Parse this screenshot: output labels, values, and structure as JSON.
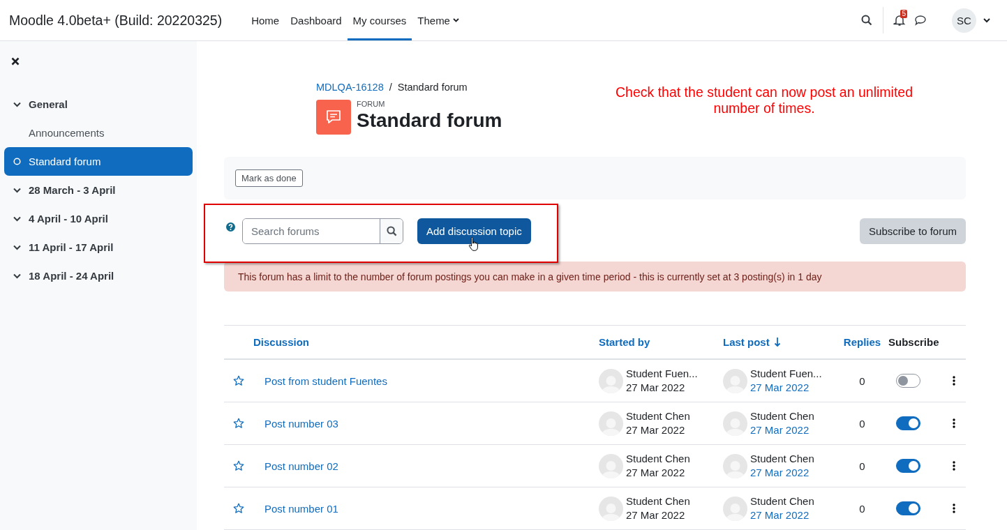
{
  "navbar": {
    "site_name": "Moodle 4.0beta+ (Build: 20220325)",
    "links": [
      {
        "label": "Home",
        "selected": false,
        "has_menu": false
      },
      {
        "label": "Dashboard",
        "selected": false,
        "has_menu": false
      },
      {
        "label": "My courses",
        "selected": true,
        "has_menu": false
      },
      {
        "label": "Theme",
        "selected": false,
        "has_menu": true
      }
    ],
    "notification_count": "5",
    "user_initials": "SC"
  },
  "sidebar": {
    "items": [
      {
        "label": "General",
        "kind": "section",
        "selected": false
      },
      {
        "label": "Announcements",
        "kind": "activity",
        "selected": false
      },
      {
        "label": "Standard forum",
        "kind": "activity",
        "selected": true
      },
      {
        "label": "28 March - 3 April",
        "kind": "section",
        "selected": false
      },
      {
        "label": "4 April - 10 April",
        "kind": "section",
        "selected": false
      },
      {
        "label": "11 April - 17 April",
        "kind": "section",
        "selected": false
      },
      {
        "label": "18 April - 24 April",
        "kind": "section",
        "selected": false
      }
    ]
  },
  "breadcrumb": [
    "MDLQA-16128",
    "Standard forum"
  ],
  "breadcrumb_separator": "/",
  "activity": {
    "type_label": "FORUM",
    "title": "Standard forum"
  },
  "annotation": "Check that the student can now post an unlimited number of times.",
  "completion_button": "Mark as done",
  "search": {
    "placeholder": "Search forums"
  },
  "add_button": "Add discussion topic",
  "subscribe_button": "Subscribe to forum",
  "alert": "This forum has a limit to the number of forum postings you can make in a given time period - this is currently set at 3 posting(s) in 1 day",
  "table": {
    "columns": [
      {
        "label": "Discussion",
        "sorted": false,
        "link": true
      },
      {
        "label": "Started by",
        "sorted": false,
        "link": true
      },
      {
        "label": "Last post",
        "sorted": true,
        "link": true
      },
      {
        "label": "Replies",
        "sorted": false,
        "link": true
      },
      {
        "label": "Subscribe",
        "sorted": false,
        "link": false
      }
    ],
    "rows": [
      {
        "title": "Post from student Fuentes",
        "started_by": {
          "name": "Student Fuen...",
          "date": "27 Mar 2022"
        },
        "last_post": {
          "name": "Student Fuen...",
          "date": "27 Mar 2022"
        },
        "replies": "0",
        "subscribed": false
      },
      {
        "title": "Post number 03",
        "started_by": {
          "name": "Student Chen",
          "date": "27 Mar 2022"
        },
        "last_post": {
          "name": "Student Chen",
          "date": "27 Mar 2022"
        },
        "replies": "0",
        "subscribed": true
      },
      {
        "title": "Post number 02",
        "started_by": {
          "name": "Student Chen",
          "date": "27 Mar 2022"
        },
        "last_post": {
          "name": "Student Chen",
          "date": "27 Mar 2022"
        },
        "replies": "0",
        "subscribed": true
      },
      {
        "title": "Post number 01",
        "started_by": {
          "name": "Student Chen",
          "date": "27 Mar 2022"
        },
        "last_post": {
          "name": "Student Chen",
          "date": "27 Mar 2022"
        },
        "replies": "0",
        "subscribed": true
      }
    ]
  }
}
